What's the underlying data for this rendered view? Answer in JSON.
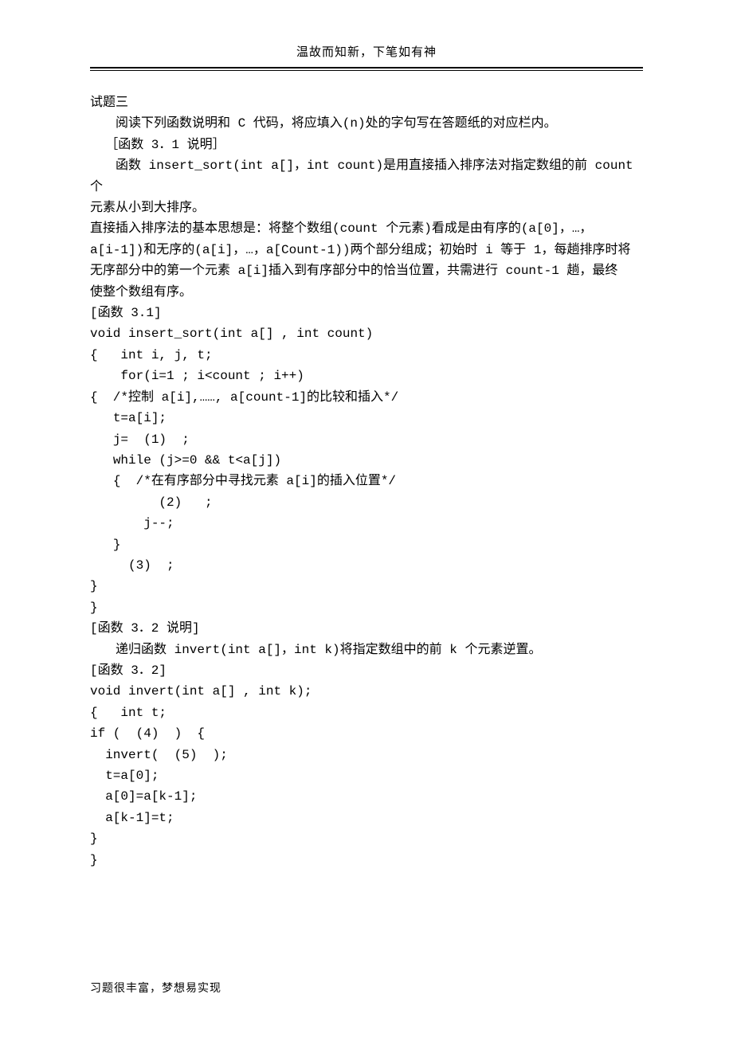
{
  "header": "温故而知新，下笔如有神",
  "footer": "习题很丰富，梦想易实现",
  "lines": {
    "l0": "试题三",
    "l1": "阅读下列函数说明和 C 代码，将应填入(n)处的字句写在答题纸的对应栏内。",
    "l2": "［函数 3．1 说明］",
    "l3": "函数 insert_sort(int a[]，int count)是用直接插入排序法对指定数组的前 count 个",
    "l4": "元素从小到大排序。",
    "l5": "直接插入排序法的基本思想是：将整个数组(count 个元素)看成是由有序的(a[0]，…，",
    "l6": "a[i-1])和无序的(a[i]，…，a[Count-1))两个部分组成；初始时 i 等于 1，每趟排序时将",
    "l7": "无序部分中的第一个元素 a[i]插入到有序部分中的恰当位置，共需进行 count-1 趟，最终",
    "l8": "使整个数组有序。",
    "l9": "[函数 3.1]",
    "l10": "void insert_sort(int a[] , int count)",
    "l11": "{   int i, j, t;",
    "l12": "    for(i=1 ; i<count ; i++)",
    "l13": "{  /*控制 a[i],……, a[count-1]的比较和插入*/",
    "l14": "   t=a[i];",
    "l15": "   j=  (1)  ;",
    "l16": "   while (j>=0 && t<a[j])",
    "l17": "   {  /*在有序部分中寻找元素 a[i]的插入位置*/",
    "l18": "         (2)   ;",
    "l19": "       j--;",
    "l20": "   }",
    "l21": "     (3)  ;",
    "l22": "}",
    "l23": "}",
    "l24": "[函数 3．2 说明]",
    "l25": "递归函数 invert(int a[]，int k)将指定数组中的前 k 个元素逆置。",
    "l26": "[函数 3．2]",
    "l27": "void invert(int a[] , int k);",
    "l28": "{   int t;",
    "l29": "if (  (4)  )  {",
    "l30": "  invert(  (5)  );",
    "l31": "  t=a[0];",
    "l32": "  a[0]=a[k-1];",
    "l33": "  a[k-1]=t;",
    "l34": "}",
    "l35": "}"
  }
}
